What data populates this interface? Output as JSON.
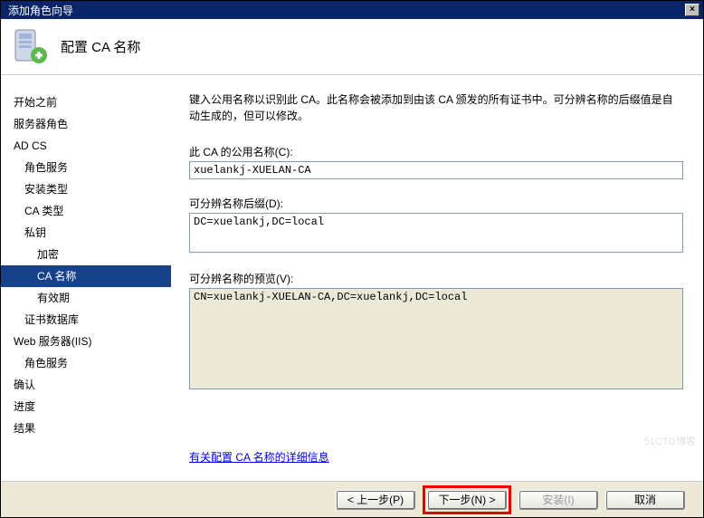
{
  "window": {
    "title": "添加角色向导",
    "close": "×"
  },
  "header": {
    "title": "配置 CA 名称"
  },
  "sidebar": {
    "items": [
      {
        "label": "开始之前",
        "level": 1
      },
      {
        "label": "服务器角色",
        "level": 1
      },
      {
        "label": "AD CS",
        "level": 1
      },
      {
        "label": "角色服务",
        "level": 2
      },
      {
        "label": "安装类型",
        "level": 2
      },
      {
        "label": "CA 类型",
        "level": 2
      },
      {
        "label": "私钥",
        "level": 2
      },
      {
        "label": "加密",
        "level": 3
      },
      {
        "label": "CA 名称",
        "level": 3,
        "selected": true
      },
      {
        "label": "有效期",
        "level": 3
      },
      {
        "label": "证书数据库",
        "level": 2
      },
      {
        "label": "Web 服务器(IIS)",
        "level": 1
      },
      {
        "label": "角色服务",
        "level": 2
      },
      {
        "label": "确认",
        "level": 1
      },
      {
        "label": "进度",
        "level": 1
      },
      {
        "label": "结果",
        "level": 1
      }
    ]
  },
  "content": {
    "description": "键入公用名称以识别此 CA。此名称会被添加到由该 CA 颁发的所有证书中。可分辨名称的后缀值是自动生成的，但可以修改。",
    "common_name_label": "此 CA 的公用名称(C):",
    "common_name_value": "xuelankj-XUELAN-CA",
    "dn_suffix_label": "可分辨名称后缀(D):",
    "dn_suffix_value": "DC=xuelankj,DC=local",
    "dn_preview_label": "可分辨名称的预览(V):",
    "dn_preview_value": "CN=xuelankj-XUELAN-CA,DC=xuelankj,DC=local",
    "help_link": "有关配置 CA 名称的详细信息"
  },
  "buttons": {
    "prev": "< 上一步(P)",
    "next": "下一步(N) >",
    "install": "安装(I)",
    "cancel": "取消"
  },
  "watermark": "51CTO博客"
}
